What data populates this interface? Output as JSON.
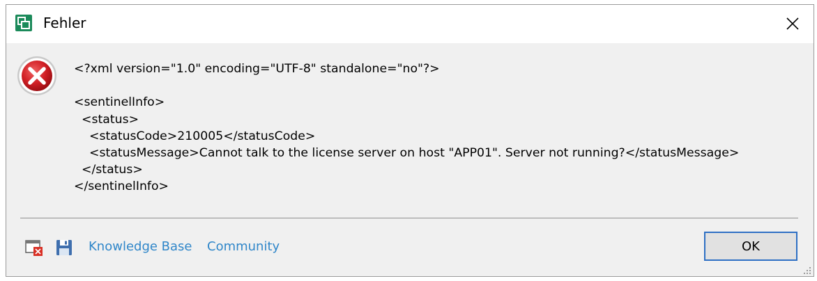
{
  "window": {
    "title": "Fehler",
    "close_glyph": "✕"
  },
  "message": {
    "lines": [
      "<?xml version=\"1.0\" encoding=\"UTF-8\" standalone=\"no\"?>",
      "",
      "<sentinelInfo>",
      "  <status>",
      "    <statusCode>210005</statusCode>",
      "    <statusMessage>Cannot talk to the license server on host \"APP01\". Server not running?</statusMessage>",
      "  </status>",
      "</sentinelInfo>"
    ]
  },
  "footer": {
    "links": {
      "knowledge_base": "Knowledge Base",
      "community": "Community"
    },
    "ok_label": "OK"
  },
  "icons": {
    "app": "app-icon",
    "error": "error-icon",
    "clear_log": "window-close-icon",
    "save": "floppy-disk-icon",
    "close": "close-icon"
  },
  "colors": {
    "link": "#2f86c9",
    "error_red": "#c8161d",
    "ok_border": "#2d6fc4",
    "app_icon_green": "#1b8a5a"
  }
}
